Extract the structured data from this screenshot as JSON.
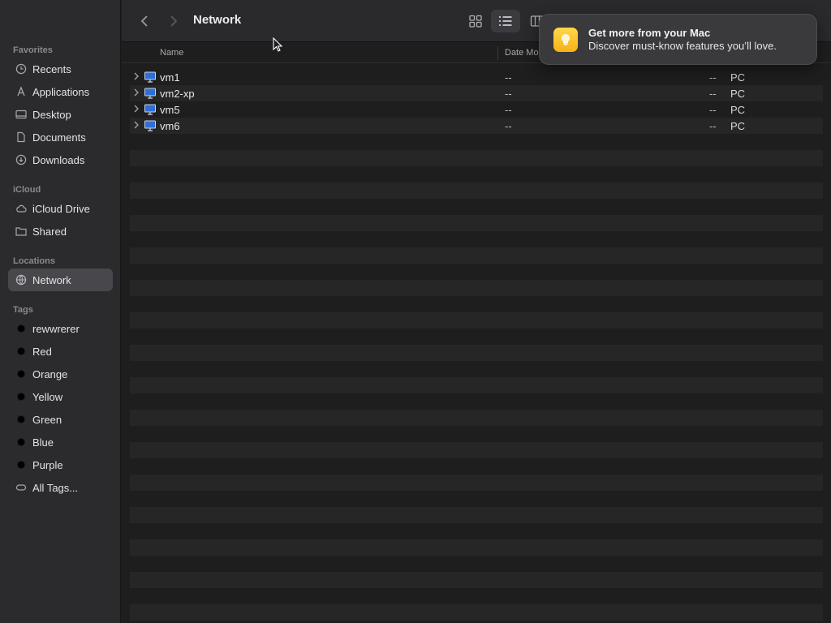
{
  "sidebar": {
    "favorites_label": "Favorites",
    "favorites": [
      {
        "label": "Recents",
        "icon": "clock-icon"
      },
      {
        "label": "Applications",
        "icon": "applications-icon"
      },
      {
        "label": "Desktop",
        "icon": "desktop-icon"
      },
      {
        "label": "Documents",
        "icon": "document-icon"
      },
      {
        "label": "Downloads",
        "icon": "download-icon"
      }
    ],
    "icloud_label": "iCloud",
    "icloud": [
      {
        "label": "iCloud Drive",
        "icon": "cloud-icon"
      },
      {
        "label": "Shared",
        "icon": "shared-folder-icon"
      }
    ],
    "locations_label": "Locations",
    "locations": [
      {
        "label": "Network",
        "icon": "globe-icon",
        "selected": true
      }
    ],
    "tags_label": "Tags",
    "tags": [
      {
        "label": "rewwrerer",
        "color": "#000000"
      },
      {
        "label": "Red",
        "color": "#000000"
      },
      {
        "label": "Orange",
        "color": "#000000"
      },
      {
        "label": "Yellow",
        "color": "#000000"
      },
      {
        "label": "Green",
        "color": "#000000"
      },
      {
        "label": "Blue",
        "color": "#000000"
      },
      {
        "label": "Purple",
        "color": "#000000"
      }
    ],
    "all_tags": "All Tags..."
  },
  "toolbar": {
    "title": "Network",
    "views": [
      "icon-view-icon",
      "list-view-icon",
      "column-view-icon"
    ],
    "active_view": "list"
  },
  "columns": {
    "name": "Name",
    "date": "Date Mo"
  },
  "rows": [
    {
      "name": "vm1",
      "date": "--",
      "size": "--",
      "kind": "PC"
    },
    {
      "name": "vm2-xp",
      "date": "--",
      "size": "--",
      "kind": "PC"
    },
    {
      "name": "vm5",
      "date": "--",
      "size": "--",
      "kind": "PC"
    },
    {
      "name": "vm6",
      "date": "--",
      "size": "--",
      "kind": "PC"
    }
  ],
  "notification": {
    "title": "Get more from your Mac",
    "body": "Discover must-know features you’ll love."
  },
  "colors": {
    "sidebar_bg": "#2b2a2d",
    "main_bg": "#1e1e1e",
    "selection": "#48474b",
    "tips_icon": "#f5b316"
  }
}
